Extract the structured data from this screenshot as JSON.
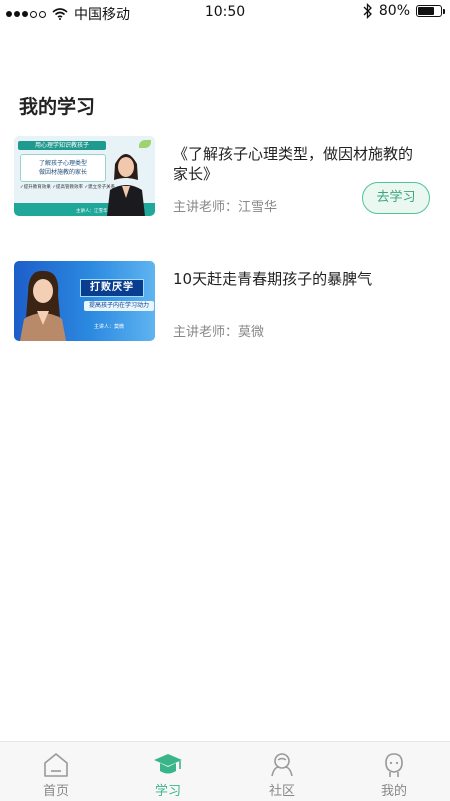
{
  "status_bar": {
    "carrier": "中国移动",
    "time": "10:50",
    "battery_percent": "80%",
    "battery_level": 0.8
  },
  "page": {
    "title": "我的学习"
  },
  "courses": [
    {
      "title": "《了解孩子心理类型，做因材施教的家长》",
      "teacher": "主讲老师：江雪华",
      "action_label": "去学习",
      "thumb": {
        "header": "用心理学知识教孩子",
        "box_line1": "了解孩子心理类型",
        "box_line2": "做因材施教的家长",
        "ticks": "✓提升教育效果 ✓提高管教效率 ✓建立亲子关系",
        "name": "主讲人：江雪华"
      }
    },
    {
      "title": "10天赶走青春期孩子的暴脾气",
      "teacher": "主讲老师：莫微",
      "thumb": {
        "big": "打败厌学",
        "sub": "提高孩子内在学习动力",
        "speaker": "主讲人：莫微"
      }
    }
  ],
  "tabbar": {
    "items": [
      {
        "label": "首页",
        "icon": "home-icon"
      },
      {
        "label": "学习",
        "icon": "graduation-cap-icon",
        "active": true
      },
      {
        "label": "社区",
        "icon": "community-icon"
      },
      {
        "label": "我的",
        "icon": "profile-icon"
      }
    ],
    "active_color": "#3ab58a",
    "inactive_color": "#888888"
  },
  "accent_color": "#4fc49a"
}
